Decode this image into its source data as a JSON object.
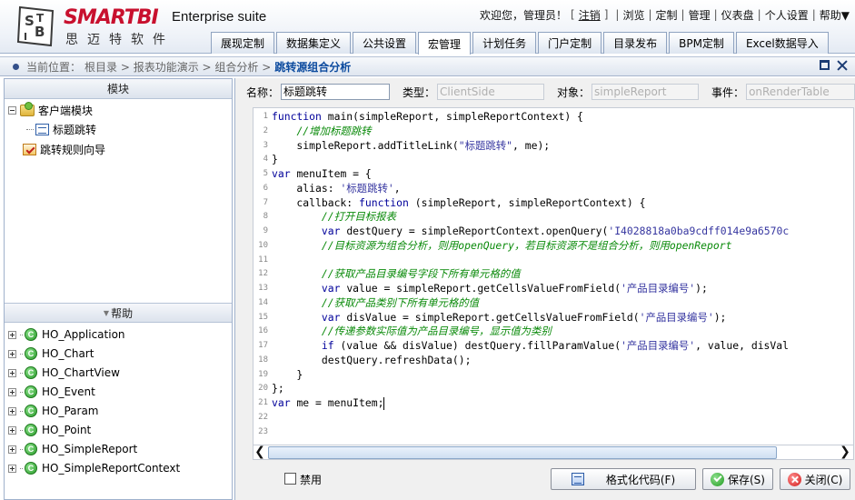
{
  "header": {
    "brand": "SMARTBI",
    "brand_cn": "思迈特软件",
    "suite": "Enterprise suite",
    "welcome": "欢迎您，管理员！",
    "logout": "注销",
    "nav": [
      "浏览",
      "定制",
      "管理",
      "仪表盘",
      "个人设置",
      "帮助▼"
    ],
    "tabs": [
      "展现定制",
      "数据集定义",
      "公共设置",
      "宏管理",
      "计划任务",
      "门户定制",
      "目录发布",
      "BPM定制",
      "Excel数据导入"
    ],
    "active_tab": "宏管理"
  },
  "breadcrumb": {
    "prefix": "当前位置：",
    "path": "根目录 > 报表功能演示 > 组合分析 >",
    "current": "跳转源组合分析"
  },
  "left": {
    "module_title": "模块",
    "tree": [
      {
        "label": "客户端模块"
      },
      {
        "label": "标题跳转"
      },
      {
        "label": "跳转规则向导"
      }
    ],
    "help_title": "帮助",
    "help_items": [
      "HO_Application",
      "HO_Chart",
      "HO_ChartView",
      "HO_Event",
      "HO_Param",
      "HO_Point",
      "HO_SimpleReport",
      "HO_SimpleReportContext"
    ]
  },
  "props": {
    "name_label": "名称：",
    "name_value": "标题跳转",
    "type_label": "类型：",
    "type_value": "ClientSide",
    "object_label": "对象：",
    "object_value": "simpleReport",
    "event_label": "事件：",
    "event_value": "onRenderTable"
  },
  "code": [
    {
      "n": "1",
      "t": [
        [
          "kw",
          "function"
        ],
        [
          "",
          "main(simpleReport, simpleReportContext) {"
        ]
      ]
    },
    {
      "n": "2",
      "t": [
        [
          "",
          "    "
        ],
        [
          "cmt",
          "//增加标题跳转"
        ]
      ]
    },
    {
      "n": "3",
      "t": [
        [
          "",
          "    simpleReport.addTitleLink("
        ],
        [
          "str",
          "\"标题跳转\""
        ],
        [
          "",
          ", me);"
        ]
      ]
    },
    {
      "n": "4",
      "t": [
        [
          "",
          "}"
        ]
      ]
    },
    {
      "n": "5",
      "t": [
        [
          "kw",
          "var"
        ],
        [
          "",
          "menuItem = {"
        ]
      ]
    },
    {
      "n": "6",
      "t": [
        [
          "",
          "    alias: "
        ],
        [
          "str",
          "'标题跳转'"
        ],
        [
          "",
          ","
        ]
      ]
    },
    {
      "n": "7",
      "t": [
        [
          "",
          "    callback: "
        ],
        [
          "kw",
          "function"
        ],
        [
          "",
          "(simpleReport, simpleReportContext) {"
        ]
      ]
    },
    {
      "n": "8",
      "t": [
        [
          "",
          "        "
        ],
        [
          "cmt",
          "//打开目标报表"
        ]
      ]
    },
    {
      "n": "9",
      "t": [
        [
          "",
          "        "
        ],
        [
          "kw",
          "var"
        ],
        [
          "",
          "destQuery = simpleReportContext.openQuery("
        ],
        [
          "str",
          "'I4028818a0ba9cdff014e9a6570c"
        ]
      ]
    },
    {
      "n": "10",
      "t": [
        [
          "",
          "        "
        ],
        [
          "cmt",
          "//目标资源为组合分析，则用openQuery，若目标资源不是组合分析，则用openReport"
        ]
      ]
    },
    {
      "n": "11",
      "t": [
        [
          "",
          ""
        ]
      ]
    },
    {
      "n": "12",
      "t": [
        [
          "",
          "        "
        ],
        [
          "cmt",
          "//获取产品目录编号字段下所有单元格的值"
        ]
      ]
    },
    {
      "n": "13",
      "t": [
        [
          "",
          "        "
        ],
        [
          "kw",
          "var"
        ],
        [
          "",
          "value = simpleReport.getCellsValueFromField("
        ],
        [
          "str",
          "'产品目录编号'"
        ],
        [
          "",
          ");"
        ]
      ]
    },
    {
      "n": "14",
      "t": [
        [
          "",
          "        "
        ],
        [
          "cmt",
          "//获取产品类别下所有单元格的值"
        ]
      ]
    },
    {
      "n": "15",
      "t": [
        [
          "",
          "        "
        ],
        [
          "kw",
          "var"
        ],
        [
          "",
          "disValue = simpleReport.getCellsValueFromField("
        ],
        [
          "str",
          "'产品目录编号'"
        ],
        [
          "",
          ");"
        ]
      ]
    },
    {
      "n": "16",
      "t": [
        [
          "",
          "        "
        ],
        [
          "cmt",
          "//传递参数实际值为产品目录编号，显示值为类别"
        ]
      ]
    },
    {
      "n": "17",
      "t": [
        [
          "",
          "        "
        ],
        [
          "kw",
          "if"
        ],
        [
          "",
          "(value && disValue) destQuery.fillParamValue("
        ],
        [
          "str",
          "'产品目录编号'"
        ],
        [
          "",
          ", value, disVal"
        ]
      ]
    },
    {
      "n": "18",
      "t": [
        [
          "",
          "        destQuery.refreshData();"
        ]
      ]
    },
    {
      "n": "19",
      "t": [
        [
          "",
          "    }"
        ]
      ]
    },
    {
      "n": "20",
      "t": [
        [
          "",
          "};"
        ]
      ]
    },
    {
      "n": "21",
      "t": [
        [
          "kw",
          "var"
        ],
        [
          "",
          "me = menuItem;"
        ]
      ]
    },
    {
      "n": "22",
      "t": [
        [
          "",
          ""
        ]
      ]
    },
    {
      "n": "23",
      "t": [
        [
          "",
          ""
        ]
      ]
    }
  ],
  "bottom": {
    "disable_label": "禁用",
    "format_label": "格式化代码(F)",
    "save_label": "保存(S)",
    "close_label": "关闭(C)"
  },
  "scroll": {
    "h_position": 0.0
  }
}
